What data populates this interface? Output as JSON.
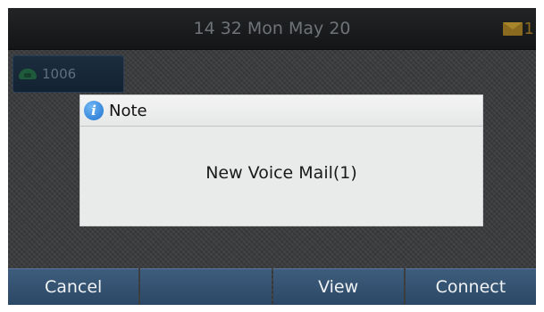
{
  "status_bar": {
    "time": "14 32 Mon May 20",
    "mail_count": "1",
    "mail_icon": "envelope-icon"
  },
  "line_key": {
    "number": "1006",
    "icon": "phone-icon"
  },
  "dialog": {
    "title": "Note",
    "message": "New Voice Mail(1)",
    "icon": "info-icon"
  },
  "softkeys": [
    {
      "label": "Cancel"
    },
    {
      "label": ""
    },
    {
      "label": "View"
    },
    {
      "label": "Connect"
    }
  ],
  "colors": {
    "softkey": "#34516f",
    "dialog_bg": "#e9eaea",
    "info_icon": "#1f73cf",
    "mail_icon": "#8a6a1e"
  }
}
